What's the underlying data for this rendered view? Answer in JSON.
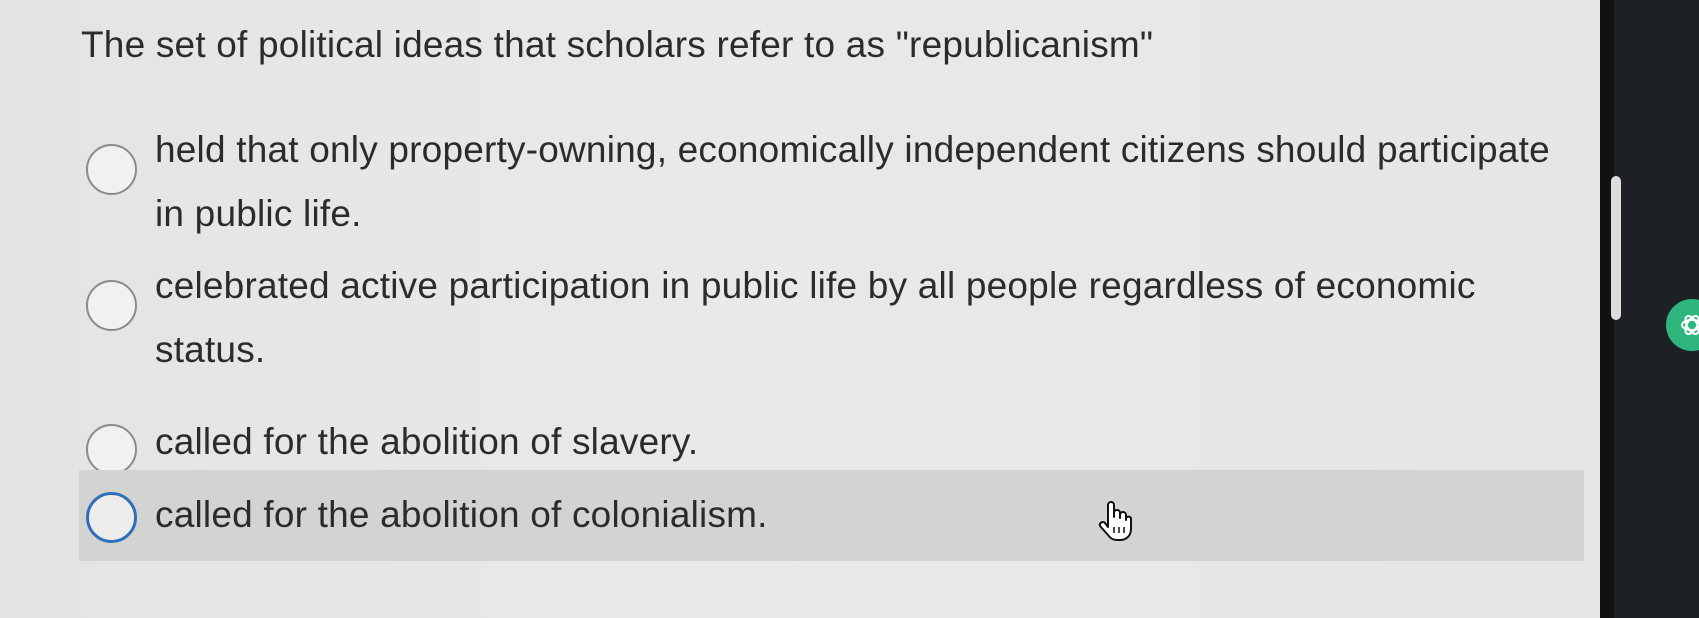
{
  "question": {
    "text": "The set of political ideas that scholars refer to as \"republicanism\""
  },
  "options": [
    {
      "label": "held that only property-owning, economically independent citizens should participate in public life."
    },
    {
      "label": "celebrated active participation in public life by all people regardless of economic status."
    },
    {
      "label": "called for the abolition of slavery."
    },
    {
      "label": "called for the abolition of colonialism."
    }
  ],
  "cursor": {
    "icon": "hand-pointer-icon"
  },
  "sidebar": {
    "assistant_icon": "chatgpt-icon"
  },
  "colors": {
    "selected_radio": "#2f6fb9",
    "hover_row": "#d3d3d1",
    "assistant_button": "#2fb57e"
  }
}
